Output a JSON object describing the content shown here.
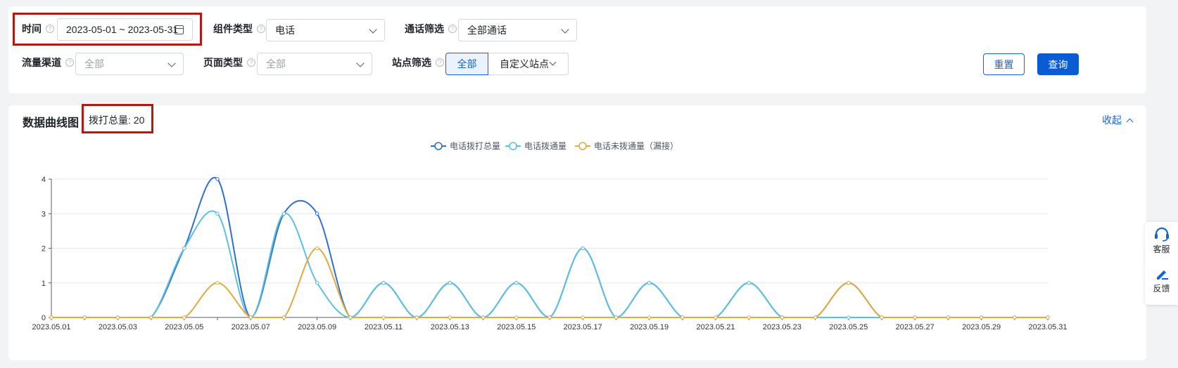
{
  "filters": {
    "time": {
      "label": "时间",
      "value": "2023-05-01 ~ 2023-05-31"
    },
    "component_type": {
      "label": "组件类型",
      "value": "电话"
    },
    "call_filter": {
      "label": "通话筛选",
      "value": "全部通话"
    },
    "traffic_channel": {
      "label": "流量渠道",
      "placeholder": "全部"
    },
    "page_type": {
      "label": "页面类型",
      "placeholder": "全部"
    },
    "site_filter": {
      "label": "站点筛选",
      "options": [
        "全部",
        "自定义站点"
      ],
      "selected": "全部"
    },
    "reset_label": "重置",
    "query_label": "查询"
  },
  "chart_panel": {
    "title": "数据曲线图",
    "total_text": "拨打总量: 20",
    "collapse_label": "收起"
  },
  "side_tools": [
    {
      "label": "客服",
      "icon": "headset-icon"
    },
    {
      "label": "反馈",
      "icon": "edit-icon"
    }
  ],
  "colors": {
    "accent": "#1664d6",
    "highlight": "#b01a14",
    "total": "#2f6fd0",
    "connected": "#5cc0e4",
    "missed": "#e4a93f"
  },
  "chart_data": {
    "type": "line",
    "smooth": true,
    "x": [
      "2023.05.01",
      "2023.05.02",
      "2023.05.03",
      "2023.05.04",
      "2023.05.05",
      "2023.05.06",
      "2023.05.07",
      "2023.05.08",
      "2023.05.09",
      "2023.05.10",
      "2023.05.11",
      "2023.05.12",
      "2023.05.13",
      "2023.05.14",
      "2023.05.15",
      "2023.05.16",
      "2023.05.17",
      "2023.05.18",
      "2023.05.19",
      "2023.05.20",
      "2023.05.21",
      "2023.05.22",
      "2023.05.23",
      "2023.05.24",
      "2023.05.25",
      "2023.05.26",
      "2023.05.27",
      "2023.05.28",
      "2023.05.29",
      "2023.05.30",
      "2023.05.31"
    ],
    "x_tick_labels": [
      "2023.05.01",
      "2023.05.03",
      "2023.05.05",
      "2023.05.07",
      "2023.05.09",
      "2023.05.11",
      "2023.05.13",
      "2023.05.15",
      "2023.05.17",
      "2023.05.19",
      "2023.05.21",
      "2023.05.23",
      "2023.05.25",
      "2023.05.27",
      "2023.05.29",
      "2023.05.31"
    ],
    "series": [
      {
        "name": "电话拨打总量",
        "color": "#2f6fd0",
        "values": [
          0,
          0,
          0,
          0,
          2,
          4,
          0,
          3,
          3,
          0,
          1,
          0,
          1,
          0,
          1,
          0,
          2,
          0,
          1,
          0,
          0,
          1,
          0,
          0,
          1,
          0,
          0,
          0,
          0,
          0,
          0
        ]
      },
      {
        "name": "电话拨通量",
        "color": "#5cc0e4",
        "values": [
          0,
          0,
          0,
          0,
          2,
          3,
          0,
          3,
          1,
          0,
          1,
          0,
          1,
          0,
          1,
          0,
          2,
          0,
          1,
          0,
          0,
          1,
          0,
          0,
          0,
          0,
          0,
          0,
          0,
          0,
          0
        ]
      },
      {
        "name": "电话未拨通量（漏接）",
        "color": "#e4a93f",
        "values": [
          0,
          0,
          0,
          0,
          0,
          1,
          0,
          0,
          2,
          0,
          0,
          0,
          0,
          0,
          0,
          0,
          0,
          0,
          0,
          0,
          0,
          0,
          0,
          0,
          1,
          0,
          0,
          0,
          0,
          0,
          0
        ]
      }
    ],
    "y_ticks": [
      0,
      1,
      2,
      3,
      4
    ],
    "ylim": [
      0,
      4
    ],
    "grid": true,
    "legend": "top-center"
  }
}
